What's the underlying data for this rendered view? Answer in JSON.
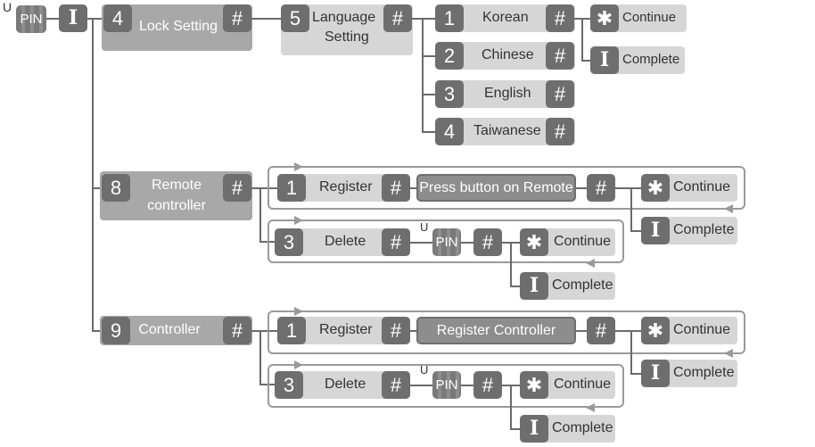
{
  "keys": {
    "pin": "PIN",
    "u": "U",
    "enter": "I",
    "hash": "#",
    "star": "✱"
  },
  "start": {
    "menu_key": "4",
    "menu_label": "Lock Setting"
  },
  "language": {
    "key": "5",
    "label_line1": "Language",
    "label_line2": "Setting",
    "options": [
      {
        "key": "1",
        "label": "Korean"
      },
      {
        "key": "2",
        "label": "Chinese"
      },
      {
        "key": "3",
        "label": "English"
      },
      {
        "key": "4",
        "label": "Taiwanese"
      }
    ]
  },
  "outcomes": {
    "continue": "Continue",
    "complete": "Complete"
  },
  "remote": {
    "key": "8",
    "label_line1": "Remote",
    "label_line2": "controller",
    "register": {
      "key": "1",
      "label": "Register",
      "action": "Press button on Remote"
    },
    "delete": {
      "key": "3",
      "label": "Delete"
    }
  },
  "controller": {
    "key": "9",
    "label": "Controller",
    "register": {
      "key": "1",
      "label": "Register",
      "action": "Register Controller"
    },
    "delete": {
      "key": "3",
      "label": "Delete"
    }
  },
  "colors": {
    "key": "#6e6e6e",
    "panel": "#a8a8a8",
    "label_bg": "#d6d6d6",
    "line": "#6a6a6a"
  }
}
